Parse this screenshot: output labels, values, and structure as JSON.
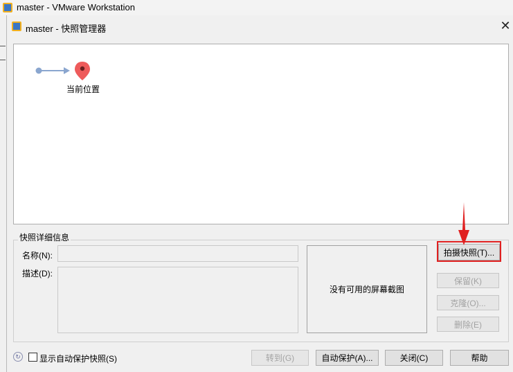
{
  "window": {
    "title": "master - VMware Workstation"
  },
  "dialog": {
    "title": "master - 快照管理器",
    "close_glyph": "✕"
  },
  "tree": {
    "current_label": "当前位置"
  },
  "details": {
    "group_title": "快照详细信息",
    "name_label": "名称(N):",
    "desc_label": "描述(D):",
    "no_screenshot": "没有可用的屏幕截图"
  },
  "side_buttons": {
    "take": "拍摄快照(T)...",
    "keep": "保留(K)",
    "clone": "克隆(O)...",
    "delete": "删除(E)"
  },
  "footer": {
    "checkbox_label": "显示自动保护快照(S)",
    "goto": "转到(G)",
    "autoprotect": "自动保护(A)...",
    "close": "关闭(C)",
    "help": "帮助"
  },
  "colors": {
    "pin": "#ee5b5b",
    "highlight": "#e02020",
    "connector": "#8aa6cf"
  }
}
